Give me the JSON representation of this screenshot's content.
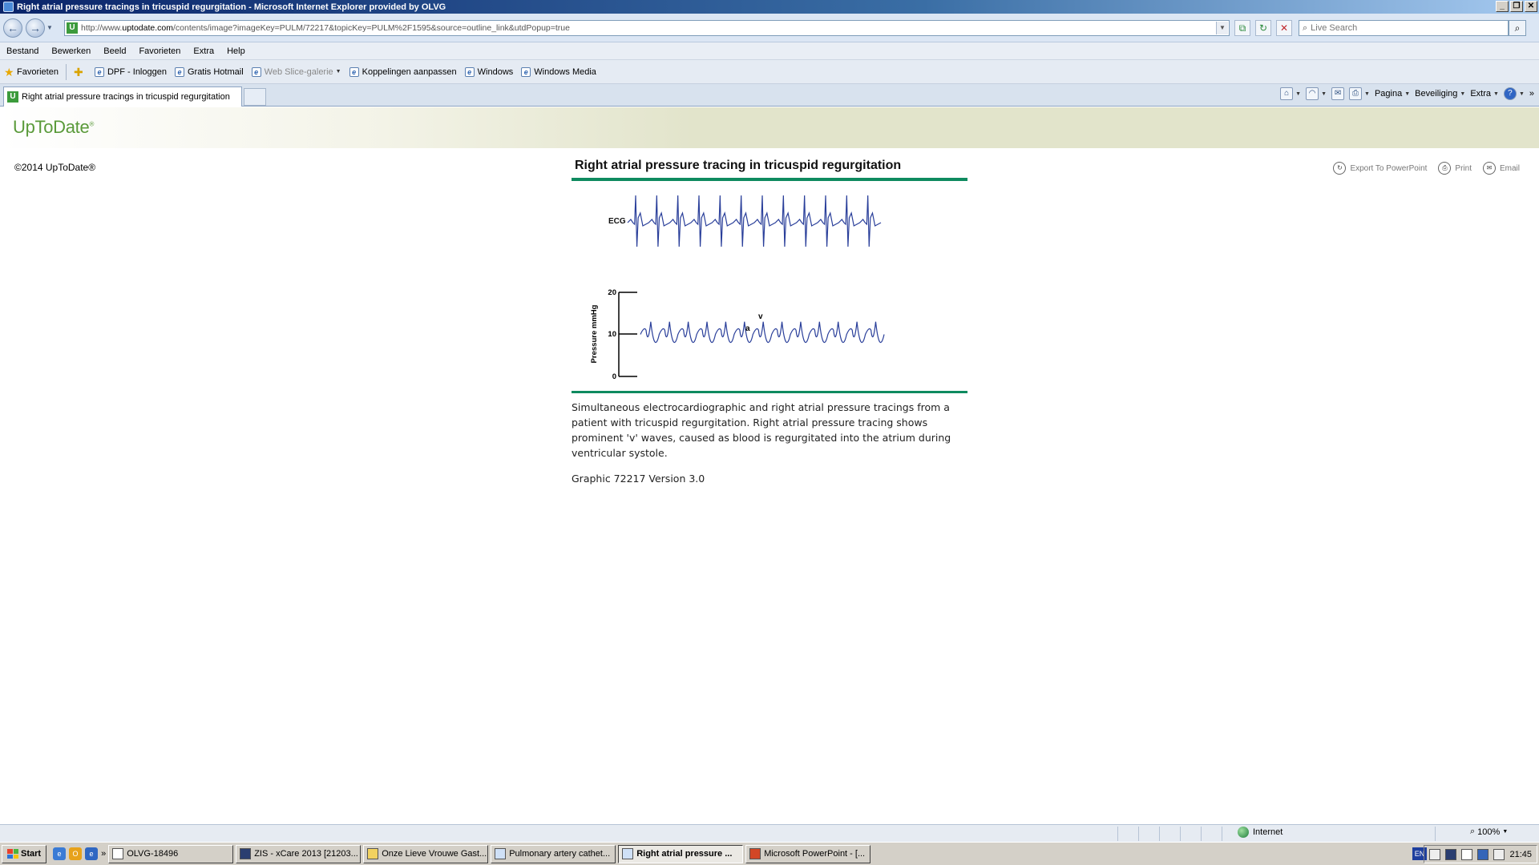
{
  "window": {
    "title": "Right atrial pressure tracings in tricuspid regurgitation - Microsoft Internet Explorer provided by OLVG"
  },
  "address": {
    "url_prefix": "http://www.",
    "url_domain": "uptodate.com",
    "url_path": "/contents/image?imageKey=PULM/72217&topicKey=PULM%2F1595&source=outline_link&utdPopup=true",
    "search_placeholder": "Live Search"
  },
  "menu": [
    "Bestand",
    "Bewerken",
    "Beeld",
    "Favorieten",
    "Extra",
    "Help"
  ],
  "favorites": {
    "label": "Favorieten",
    "links": [
      "DPF - Inloggen",
      "Gratis Hotmail",
      "Web Slice-galerie",
      "Koppelingen aanpassen",
      "Windows",
      "Windows Media"
    ]
  },
  "tab": {
    "title": "Right atrial pressure tracings in tricuspid regurgitation"
  },
  "commandbar": {
    "pagina": "Pagina",
    "beveiliging": "Beveiliging",
    "extra": "Extra"
  },
  "site": {
    "logo": "UpToDate",
    "logo_mark": "®",
    "copyright": "©2014 UpToDate®",
    "actions": {
      "export": "Export To PowerPoint",
      "print": "Print",
      "email": "Email"
    }
  },
  "figure": {
    "title": "Right atrial pressure tracing in tricuspid regurgitation",
    "ecg_label": "ECG",
    "ylabel": "Pressure mmHg",
    "ticks": [
      "20",
      "10",
      "0"
    ],
    "wave_a": "a",
    "wave_v": "v",
    "caption": "Simultaneous electrocardiographic and right atrial pressure tracings from a patient with tricuspid regurgitation. Right atrial pressure tracing shows prominent 'v' waves, caused as blood is regurgitated into the atrium during ventricular systole.",
    "graphic_version": "Graphic 72217 Version 3.0"
  },
  "chart_data": {
    "type": "line",
    "title": "Right atrial pressure tracing in tricuspid regurgitation",
    "ylabel": "Pressure mmHg",
    "ylim": [
      0,
      20
    ],
    "yticks": [
      0,
      10,
      20
    ],
    "series": [
      {
        "name": "ECG",
        "beats": 12
      },
      {
        "name": "Right atrial pressure",
        "mean_mmHg": 10,
        "a_wave_mmHg": 11,
        "v_wave_mmHg": 13,
        "trough_mmHg": 5
      }
    ]
  },
  "statusbar": {
    "zone": "Internet",
    "zoom": "100%"
  },
  "taskbar": {
    "start": "Start",
    "tasks": [
      "OLVG-18496",
      "ZIS - xCare 2013 [21203...",
      "Onze Lieve Vrouwe Gast...",
      "Pulmonary artery cathet...",
      "Right atrial pressure ...",
      "Microsoft PowerPoint - [..."
    ],
    "lang": "EN",
    "time": "21:45"
  }
}
